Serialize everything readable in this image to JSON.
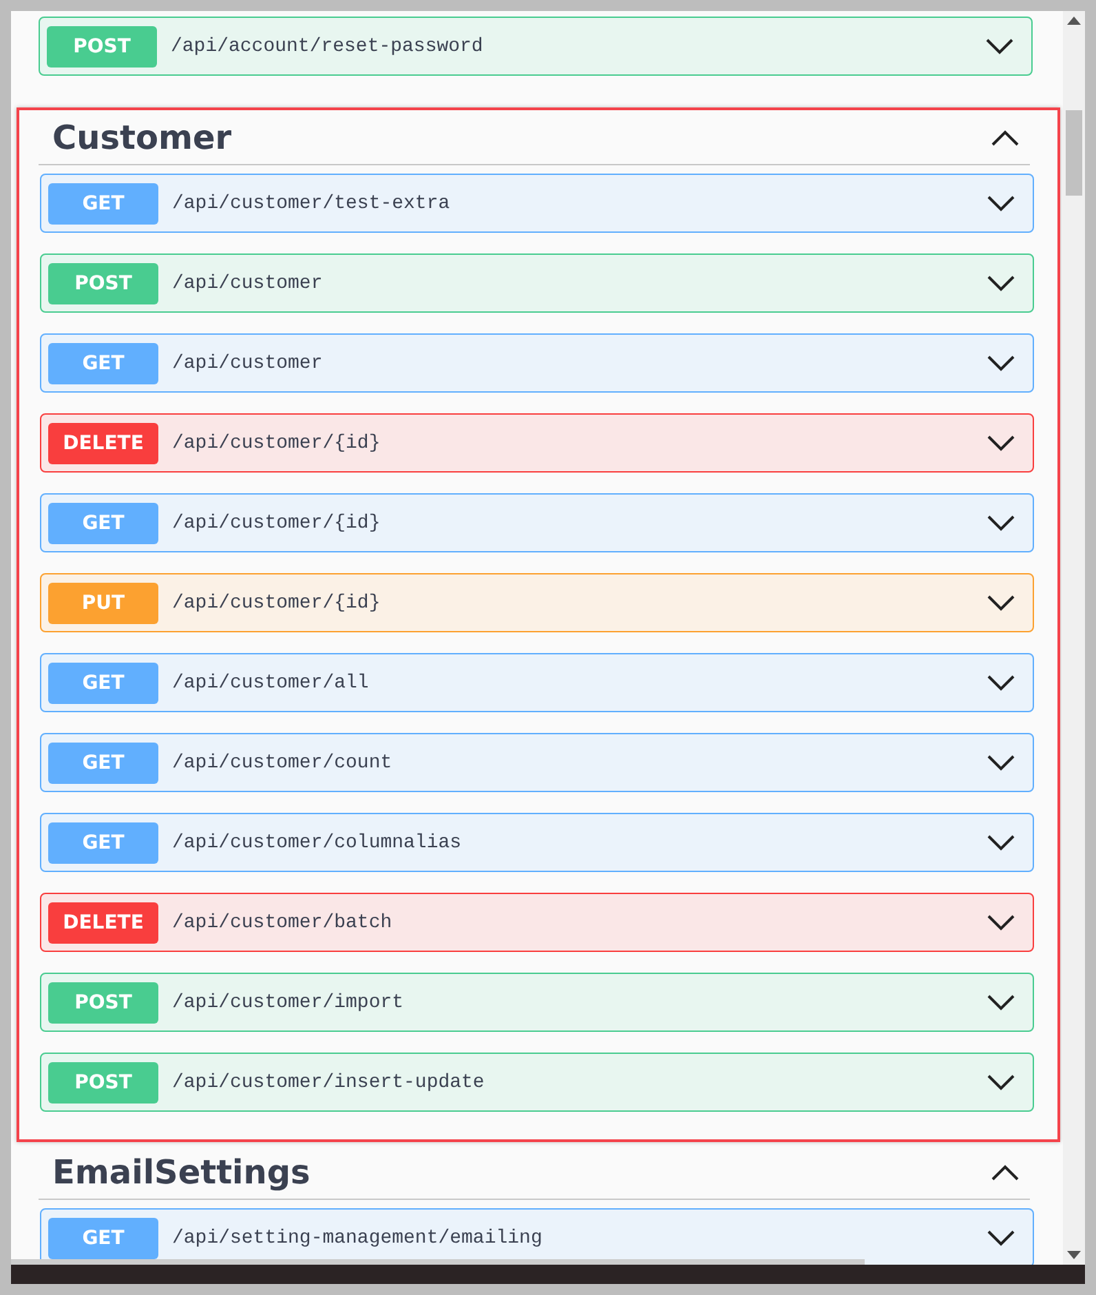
{
  "operations_above": [
    {
      "kind": "post",
      "method": "POST",
      "path": "/api/account/reset-password"
    }
  ],
  "sections": [
    {
      "name": "Customer",
      "expanded": true,
      "highlighted": true,
      "operations": [
        {
          "kind": "get",
          "method": "GET",
          "path": "/api/customer/test-extra"
        },
        {
          "kind": "post",
          "method": "POST",
          "path": "/api/customer"
        },
        {
          "kind": "get",
          "method": "GET",
          "path": "/api/customer"
        },
        {
          "kind": "delete",
          "method": "DELETE",
          "path": "/api/customer/{id}"
        },
        {
          "kind": "get",
          "method": "GET",
          "path": "/api/customer/{id}"
        },
        {
          "kind": "put",
          "method": "PUT",
          "path": "/api/customer/{id}"
        },
        {
          "kind": "get",
          "method": "GET",
          "path": "/api/customer/all"
        },
        {
          "kind": "get",
          "method": "GET",
          "path": "/api/customer/count"
        },
        {
          "kind": "get",
          "method": "GET",
          "path": "/api/customer/columnalias"
        },
        {
          "kind": "delete",
          "method": "DELETE",
          "path": "/api/customer/batch"
        },
        {
          "kind": "post",
          "method": "POST",
          "path": "/api/customer/import"
        },
        {
          "kind": "post",
          "method": "POST",
          "path": "/api/customer/insert-update"
        }
      ]
    },
    {
      "name": "EmailSettings",
      "expanded": true,
      "highlighted": false,
      "operations": [
        {
          "kind": "get",
          "method": "GET",
          "path": "/api/setting-management/emailing"
        }
      ]
    }
  ]
}
